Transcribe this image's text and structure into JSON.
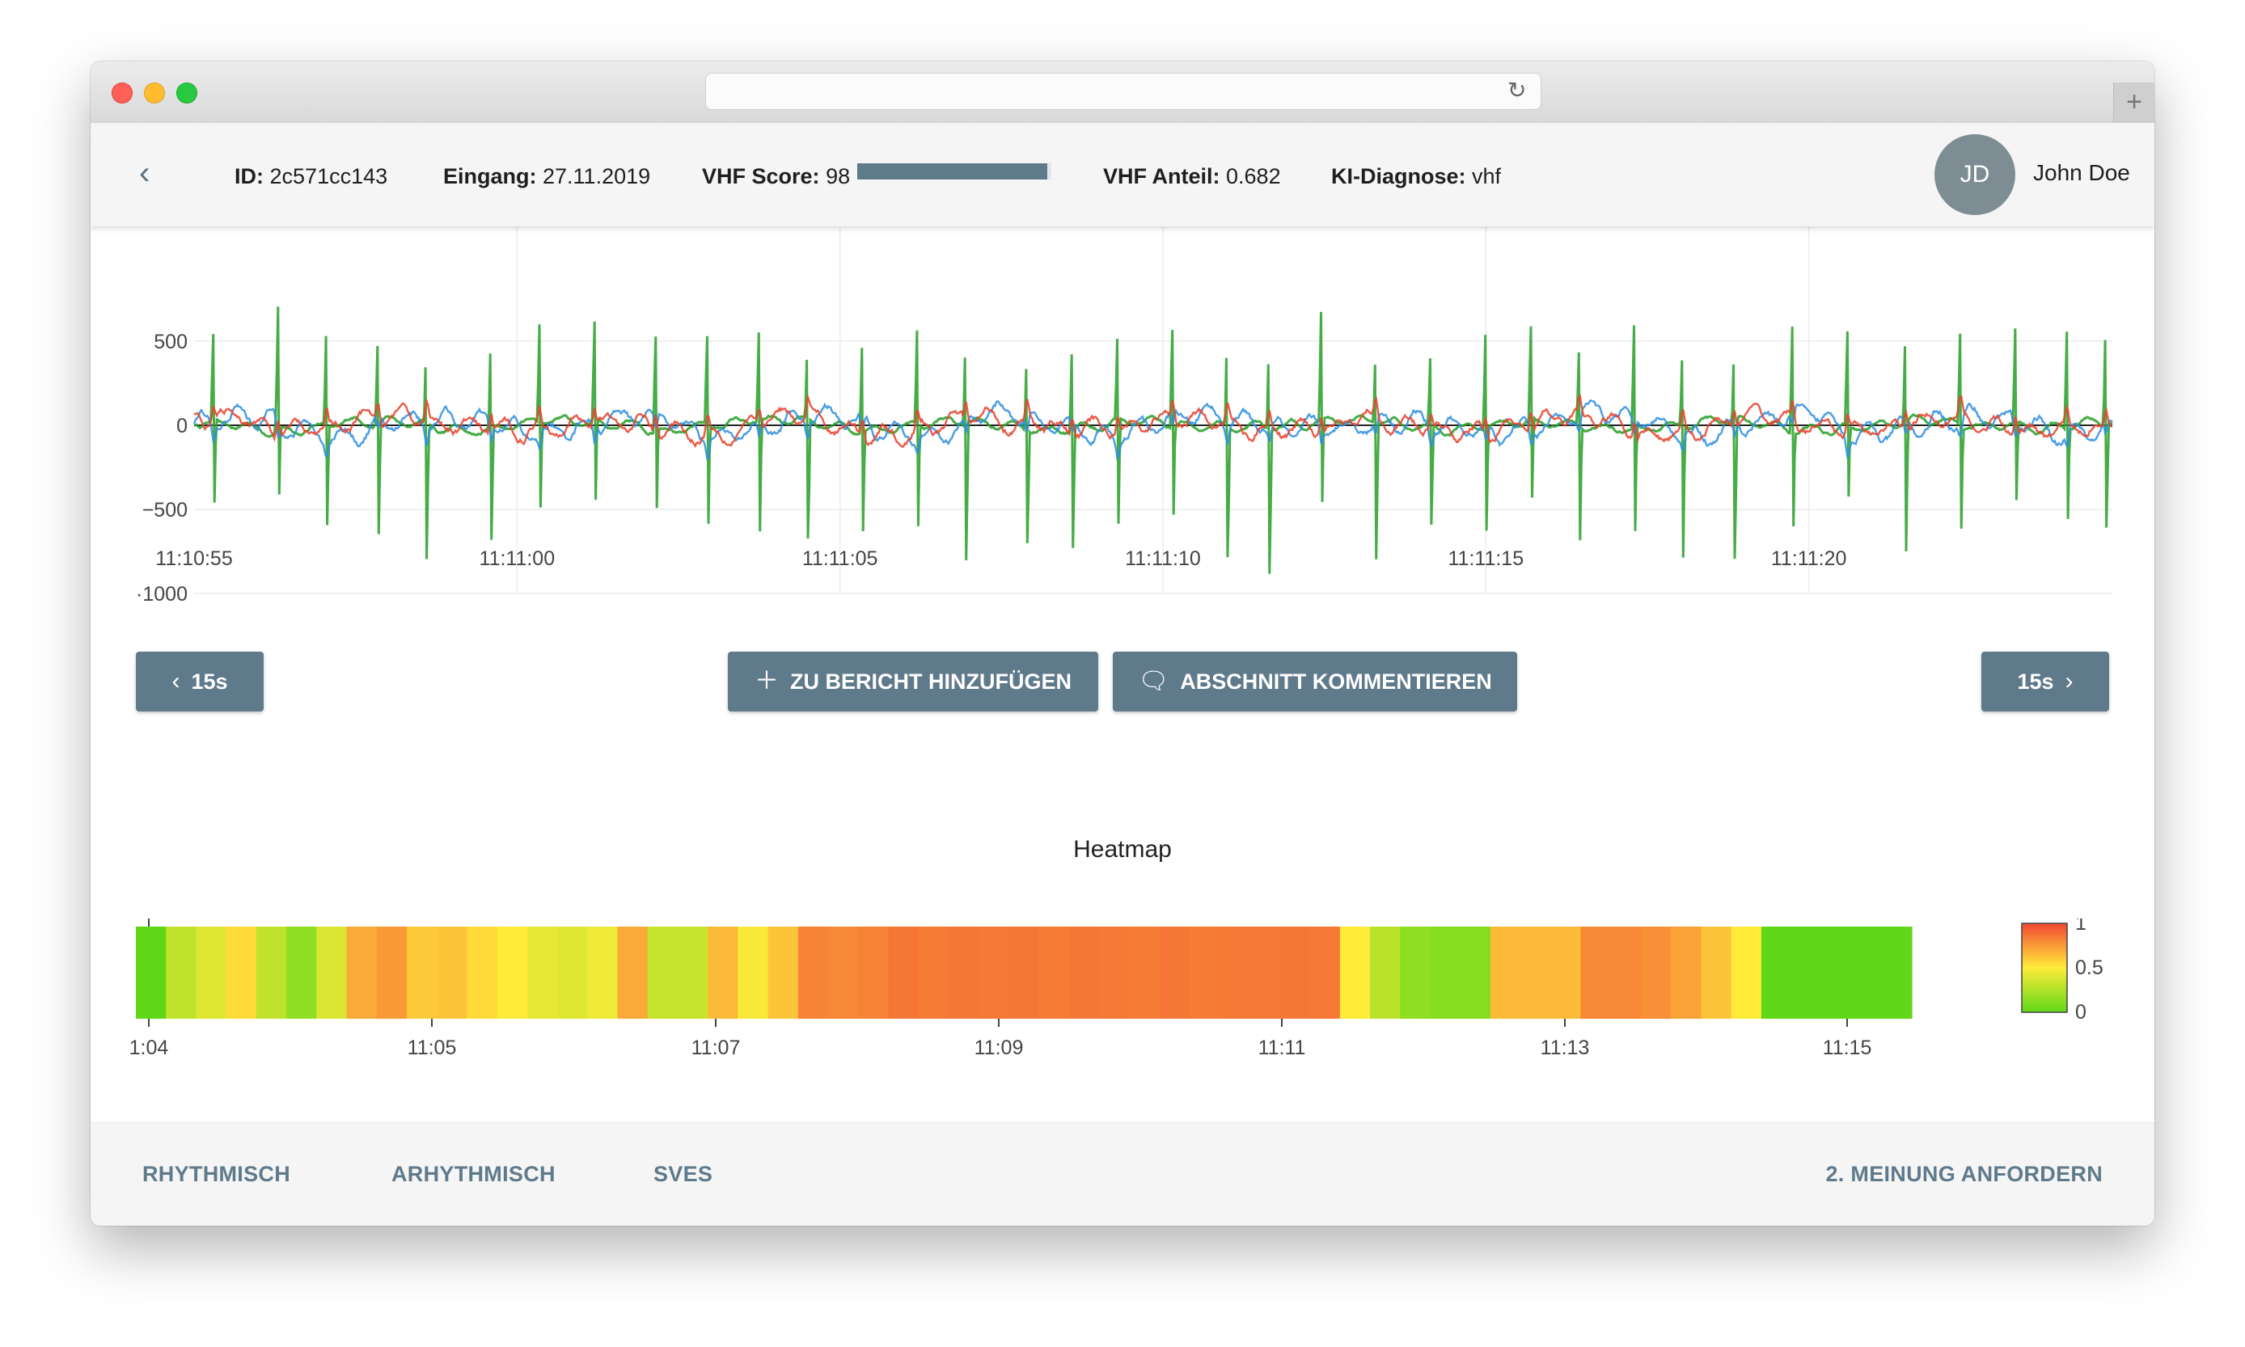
{
  "browser": {
    "url": "",
    "new_tab_label": "+",
    "reload_icon": "reload-icon"
  },
  "header": {
    "back_icon": "chevron-left-icon",
    "id_label": "ID:",
    "id_value": "2c571cc143",
    "eingang_label": "Eingang:",
    "eingang_value": "27.11.2019",
    "score_label": "VHF Score:",
    "score_value": "98",
    "score_fraction": 0.98,
    "anteil_label": "VHF Anteil:",
    "anteil_value": "0.682",
    "diagnose_label": "KI-Diagnose:",
    "diagnose_value": "vhf",
    "avatar_initials": "JD",
    "user_name": "John Doe"
  },
  "controls": {
    "prev_label": "15s",
    "next_label": "15s",
    "add_report_label": "ZU BERICHT HINZUFÜGEN",
    "comment_label": "ABSCHNITT KOMMENTIEREN"
  },
  "chart_data": [
    {
      "type": "line",
      "title": "",
      "xlabel": "",
      "ylabel": "",
      "ylim": [
        -1000,
        700
      ],
      "yticks": [
        "500",
        "0",
        "−500",
        "·1000"
      ],
      "yticks_values": [
        500,
        0,
        -500,
        -1000
      ],
      "xticks": [
        "11:10:55",
        "11:11:00",
        "11:11:05",
        "11:11:10",
        "11:11:15",
        "11:11:20"
      ],
      "x_range": [
        "11:10:55",
        "11:11:24.7"
      ],
      "grid": true,
      "series": [
        {
          "color": "#2f8fe0",
          "description": "blue lead, amplitude ~±150"
        },
        {
          "color": "#e8432e",
          "description": "red lead, amplitude ~±120"
        },
        {
          "color": "#2ca02c",
          "description": "green lead, QRS peaks ~+650 / -900"
        }
      ],
      "qrs_times_s": [
        0.3,
        1.3,
        2.05,
        2.85,
        3.6,
        4.6,
        5.35,
        6.2,
        7.15,
        7.95,
        8.75,
        9.5,
        10.35,
        11.2,
        11.95,
        12.9,
        13.6,
        14.3,
        15.15,
        16.0,
        16.65,
        17.45,
        18.3,
        19.15,
        20.0,
        20.7,
        21.45,
        22.3,
        23.05,
        23.85,
        24.75,
        25.6,
        26.5,
        27.35,
        28.2,
        29.0,
        29.6
      ]
    },
    {
      "type": "heatmap",
      "title": "Heatmap",
      "xticks": [
        "1:04",
        "11:05",
        "11:07",
        "11:09",
        "11:11",
        "11:13",
        "11:15"
      ],
      "colorbar": {
        "ticks": [
          "1",
          "0.5",
          "0"
        ],
        "min": 0,
        "max": 1
      },
      "values": [
        0.0,
        0.3,
        0.4,
        0.55,
        0.3,
        0.15,
        0.38,
        0.7,
        0.75,
        0.6,
        0.62,
        0.55,
        0.5,
        0.42,
        0.4,
        0.45,
        0.7,
        0.32,
        0.32,
        0.65,
        0.48,
        0.62,
        0.82,
        0.8,
        0.82,
        0.86,
        0.84,
        0.86,
        0.85,
        0.86,
        0.84,
        0.86,
        0.85,
        0.84,
        0.86,
        0.84,
        0.85,
        0.85,
        0.86,
        0.85,
        0.5,
        0.28,
        0.15,
        0.12,
        0.12,
        0.65,
        0.65,
        0.65,
        0.8,
        0.8,
        0.78,
        0.72,
        0.62,
        0.5,
        0.0,
        0.0,
        0.0,
        0.0,
        0.0
      ],
      "segment_minutes": 0.19
    }
  ],
  "footer": {
    "rhythmisch": "RHYTHMISCH",
    "arrhythmisch": "ARHYTHMISCH",
    "sves": "SVES",
    "second_opinion": "2. MEINUNG ANFORDERN"
  }
}
